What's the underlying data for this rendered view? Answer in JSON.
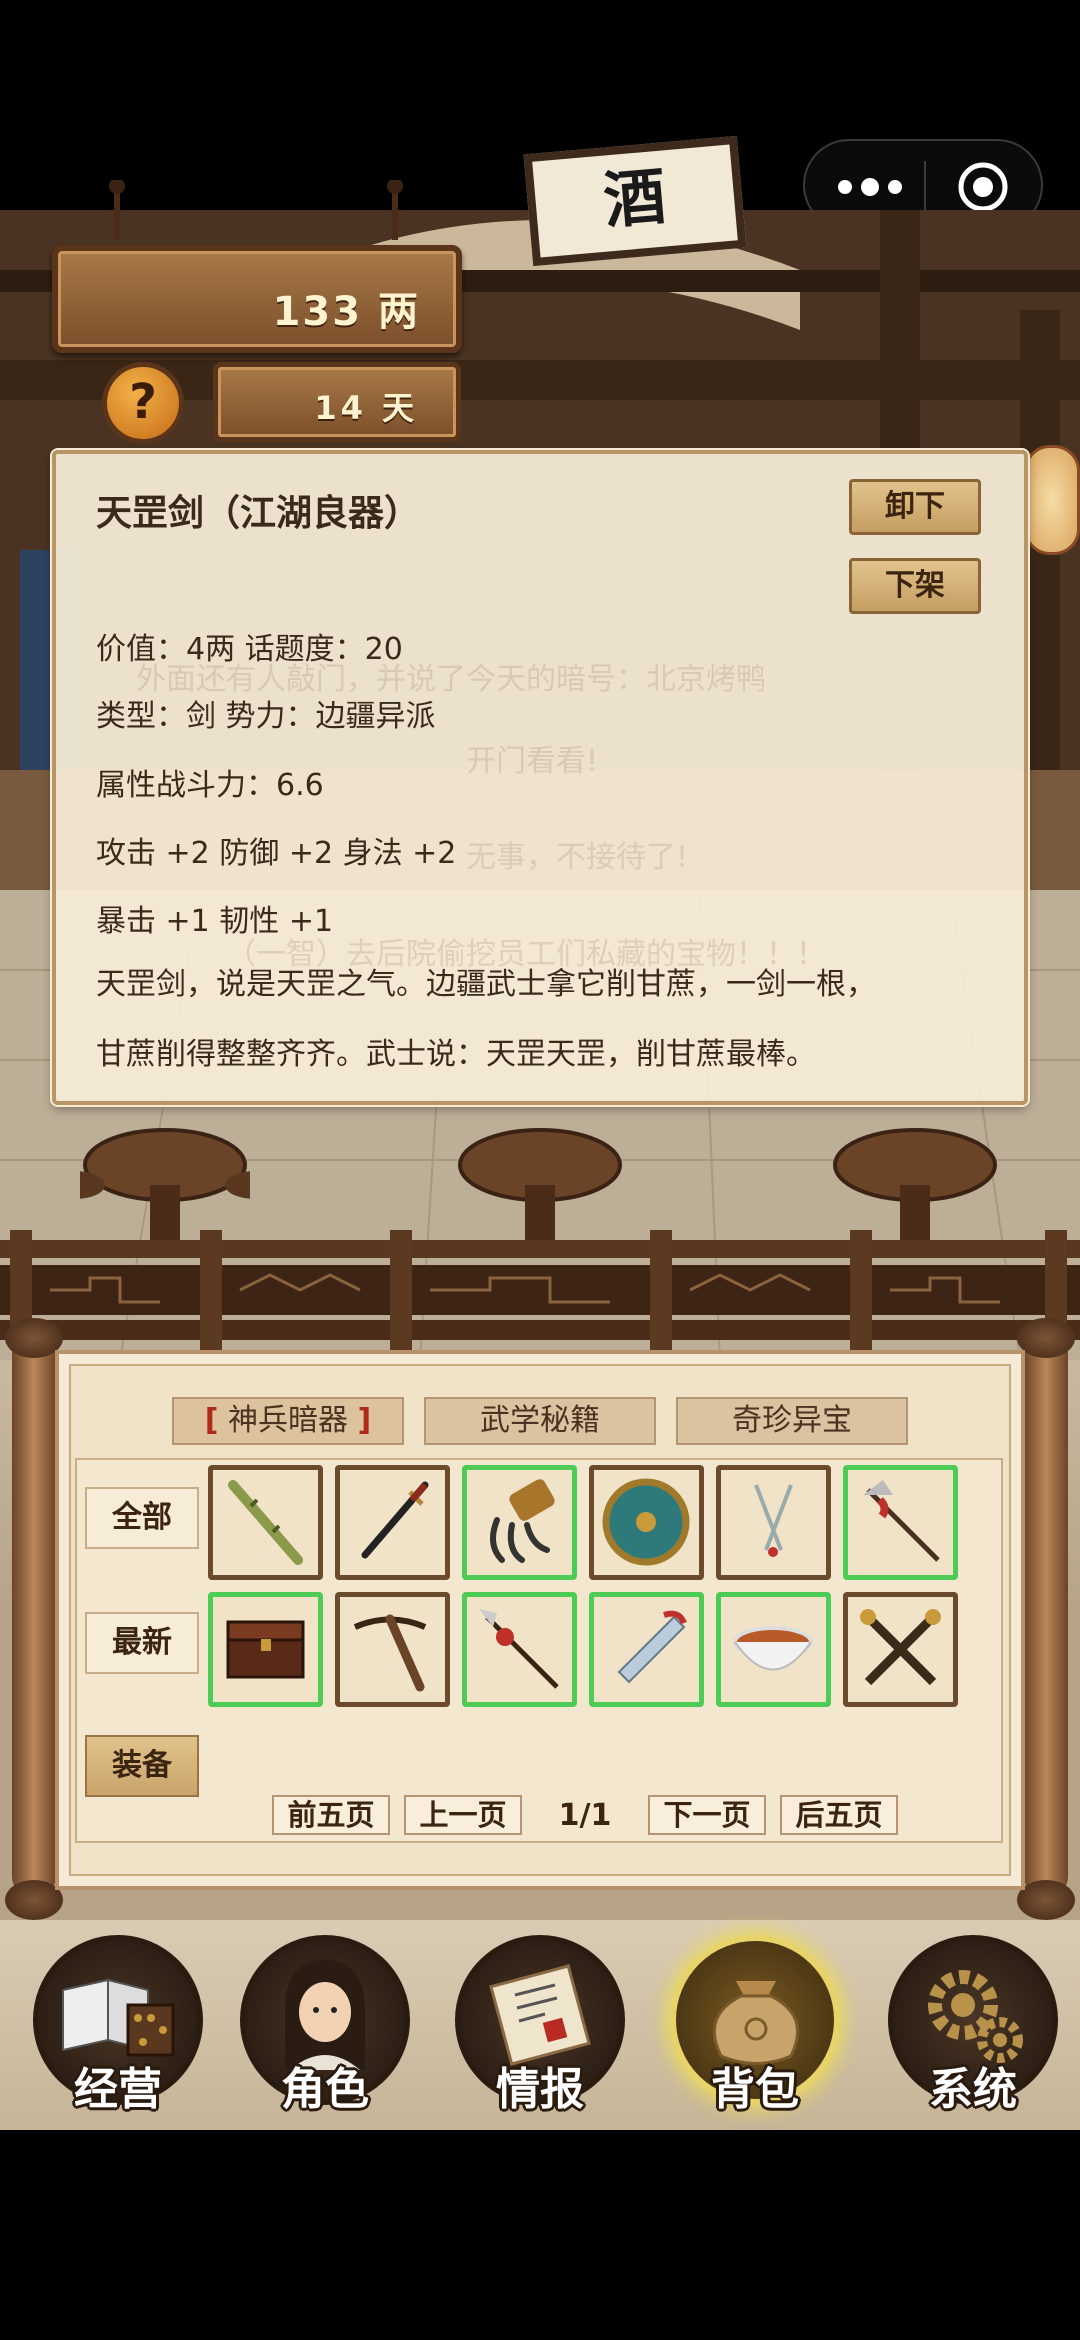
{
  "resources": {
    "money": "133 两",
    "days": "14 天",
    "help_symbol": "?"
  },
  "scene": {
    "sign_text": "酒"
  },
  "item_detail": {
    "name": "天罡剑（江湖良器）",
    "unequip_label": "卸下",
    "delist_label": "下架",
    "lines": [
      "价值：4两   话题度：20",
      "类型：剑   势力：边疆异派",
      "属性战斗力：6.6",
      "攻击 +2   防御 +2   身法 +2",
      "暴击 +1   韧性 +1",
      "天罡剑，说是天罡之气。边疆武士拿它削甘蔗，一剑一根，",
      "甘蔗削得整整齐齐。武士说：天罡天罡，削甘蔗最棒。"
    ],
    "background_text": [
      "外面还有人敲门，并说了今天的暗号：北京烤鸭",
      "开门看看!",
      "无事，不接待了!",
      "（一智）去后院偷挖员工们私藏的宝物！！！"
    ]
  },
  "inventory": {
    "tabs": [
      {
        "bracket_left": "[",
        "label": "神兵暗器",
        "bracket_right": "]",
        "active": true
      },
      {
        "label": "武学秘籍",
        "active": false
      },
      {
        "label": "奇珍异宝",
        "active": false
      }
    ],
    "filters": {
      "all": "全部",
      "newest": "最新",
      "equip": "装备"
    },
    "row1": [
      {
        "icon": "bamboo-staff-icon",
        "highlight": false
      },
      {
        "icon": "katana-icon",
        "highlight": false
      },
      {
        "icon": "iron-claw-icon",
        "highlight": true
      },
      {
        "icon": "round-shield-icon",
        "highlight": false
      },
      {
        "icon": "twin-daggers-icon",
        "highlight": false
      },
      {
        "icon": "halberd-icon",
        "highlight": true
      }
    ],
    "row2": [
      {
        "icon": "treasure-chest-icon",
        "highlight": true
      },
      {
        "icon": "crossbow-icon",
        "highlight": false
      },
      {
        "icon": "red-tassel-spear-icon",
        "highlight": true
      },
      {
        "icon": "broad-saber-icon",
        "highlight": true
      },
      {
        "icon": "soup-bowl-icon",
        "highlight": true
      },
      {
        "icon": "crossed-maces-icon",
        "highlight": false
      }
    ],
    "pagination": {
      "first5": "前五页",
      "prev": "上一页",
      "page": "1/1",
      "next": "下一页",
      "last5": "后五页"
    }
  },
  "nav": [
    {
      "label": "经营",
      "icon": "ledger-abacus-icon",
      "active": false
    },
    {
      "label": "角色",
      "icon": "character-portrait-icon",
      "active": false
    },
    {
      "label": "情报",
      "icon": "scroll-icon",
      "active": false
    },
    {
      "label": "背包",
      "icon": "money-bag-icon",
      "active": true
    },
    {
      "label": "系统",
      "icon": "gears-icon",
      "active": false
    }
  ],
  "colors": {
    "highlight_border": "#4ccc54",
    "panel_bg": "#f6ecd7",
    "wood": "#7b4f2a",
    "active_glow": "#e8d36a"
  }
}
